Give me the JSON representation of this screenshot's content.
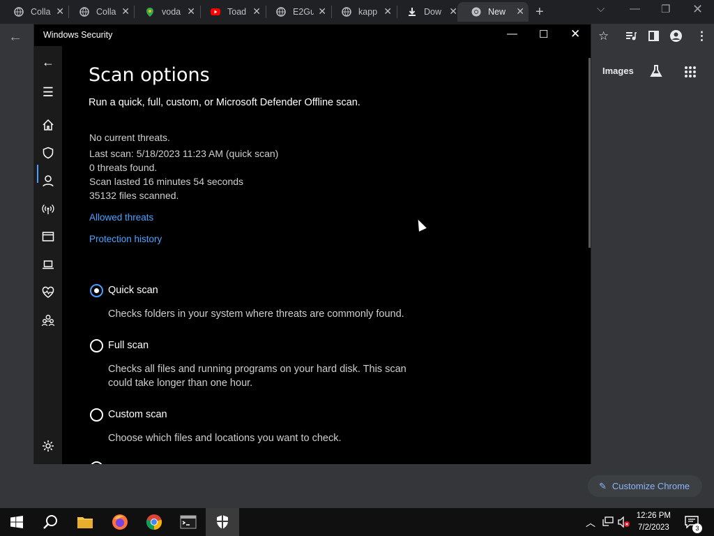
{
  "chrome": {
    "tabs": [
      {
        "title": "Colla",
        "icon": "globe-icon"
      },
      {
        "title": "Colla",
        "icon": "globe-icon"
      },
      {
        "title": "voda",
        "icon": "maps-pin-icon"
      },
      {
        "title": "Toad",
        "icon": "youtube-icon"
      },
      {
        "title": "E2Gu",
        "icon": "globe-icon"
      },
      {
        "title": "kapp",
        "icon": "globe-icon"
      },
      {
        "title": "Dow",
        "icon": "download-icon"
      },
      {
        "title": "New",
        "icon": "chrome-icon"
      }
    ],
    "images_label": "Images",
    "customize_label": "Customize Chrome"
  },
  "window": {
    "title": "Windows Security"
  },
  "page": {
    "title": "Scan options",
    "subtitle": "Run a quick, full, custom, or Microsoft Defender Offline scan.",
    "status": {
      "threats": "No current threats.",
      "last_scan": "Last scan: 5/18/2023 11:23 AM (quick scan)",
      "found": "0 threats found.",
      "duration": "Scan lasted 16 minutes 54 seconds",
      "files": "35132 files scanned."
    },
    "links": {
      "allowed": "Allowed threats",
      "history": "Protection history"
    },
    "options": [
      {
        "label": "Quick scan",
        "desc": "Checks folders in your system where threats are commonly found.",
        "selected": true
      },
      {
        "label": "Full scan",
        "desc": "Checks all files and running programs on your hard disk. This scan could take longer than one hour.",
        "selected": false
      },
      {
        "label": "Custom scan",
        "desc": "Choose which files and locations you want to check.",
        "selected": false
      }
    ]
  },
  "taskbar": {
    "time": "12:26 PM",
    "date": "7/2/2023",
    "notification_count": "3"
  },
  "colors": {
    "accent": "#4a9eff",
    "link": "#4aa3ff",
    "chrome_link": "#8ab4f8"
  }
}
